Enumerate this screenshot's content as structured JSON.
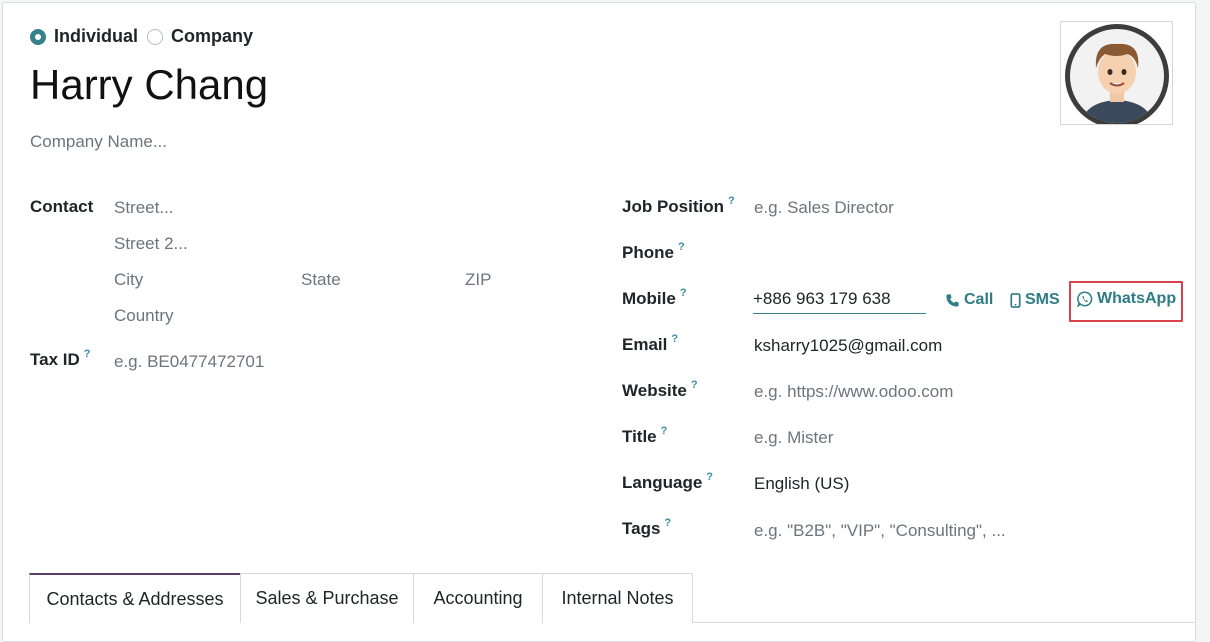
{
  "type_selector": {
    "individual_label": "Individual",
    "company_label": "Company",
    "selected": "Individual"
  },
  "contact_name": "Harry Chang",
  "company_name_placeholder": "Company Name...",
  "address": {
    "label": "Contact",
    "street_placeholder": "Street...",
    "street2_placeholder": "Street 2...",
    "city_placeholder": "City",
    "state_placeholder": "State",
    "zip_placeholder": "ZIP",
    "country_placeholder": "Country"
  },
  "tax_id": {
    "label": "Tax ID",
    "help": "?",
    "placeholder": "e.g. BE0477472701"
  },
  "fields": {
    "job_position": {
      "label": "Job Position",
      "help": "?",
      "placeholder": "e.g. Sales Director"
    },
    "phone": {
      "label": "Phone",
      "help": "?",
      "value": ""
    },
    "mobile": {
      "label": "Mobile",
      "help": "?",
      "value": "+886 963 179 638"
    },
    "email": {
      "label": "Email",
      "help": "?",
      "value": "ksharry1025@gmail.com"
    },
    "website": {
      "label": "Website",
      "help": "?",
      "placeholder": "e.g. https://www.odoo.com"
    },
    "title": {
      "label": "Title",
      "help": "?",
      "placeholder": "e.g. Mister"
    },
    "language": {
      "label": "Language",
      "help": "?",
      "value": "English (US)"
    },
    "tags": {
      "label": "Tags",
      "help": "?",
      "placeholder": "e.g. \"B2B\", \"VIP\", \"Consulting\", ..."
    }
  },
  "mobile_actions": {
    "call_label": "Call",
    "sms_label": "SMS",
    "whatsapp_label": "WhatsApp"
  },
  "tabs": [
    {
      "label": "Contacts & Addresses",
      "active": true
    },
    {
      "label": "Sales & Purchase",
      "active": false
    },
    {
      "label": "Accounting",
      "active": false
    },
    {
      "label": "Internal Notes",
      "active": false
    }
  ],
  "colors": {
    "accent": "#37828a",
    "highlight_box": "#d9434d",
    "active_tab": "#5b3f67"
  },
  "icons": {
    "call": "phone-icon",
    "sms": "mobile-icon",
    "whatsapp": "whatsapp-icon"
  }
}
